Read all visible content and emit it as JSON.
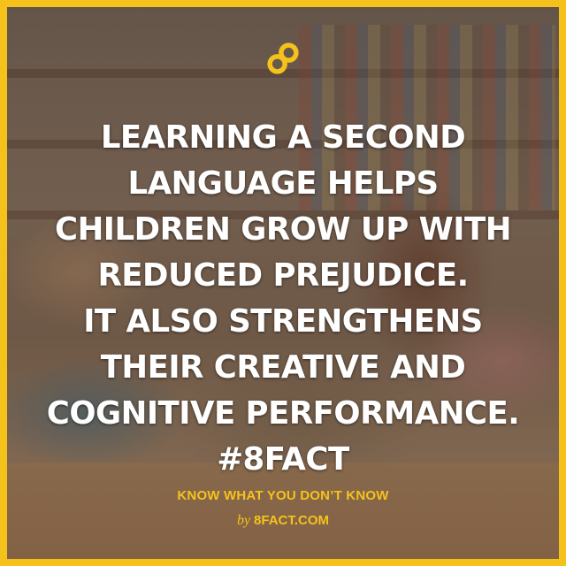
{
  "brand": {
    "accent_color": "#f4c21a",
    "logo_icon": "infinity-eight-icon"
  },
  "headline": {
    "lines": [
      "LEARNING A SECOND",
      "LANGUAGE HELPS",
      "CHILDREN GROW UP WITH",
      "REDUCED PREJUDICE.",
      "IT ALSO STRENGTHENS",
      "THEIR CREATIVE AND",
      "COGNITIVE PERFORMANCE.",
      "#8FACT"
    ]
  },
  "footer": {
    "tagline": "KNOW WHAT YOU DON’T KNOW",
    "by": "by",
    "site": "8FACT.COM"
  }
}
